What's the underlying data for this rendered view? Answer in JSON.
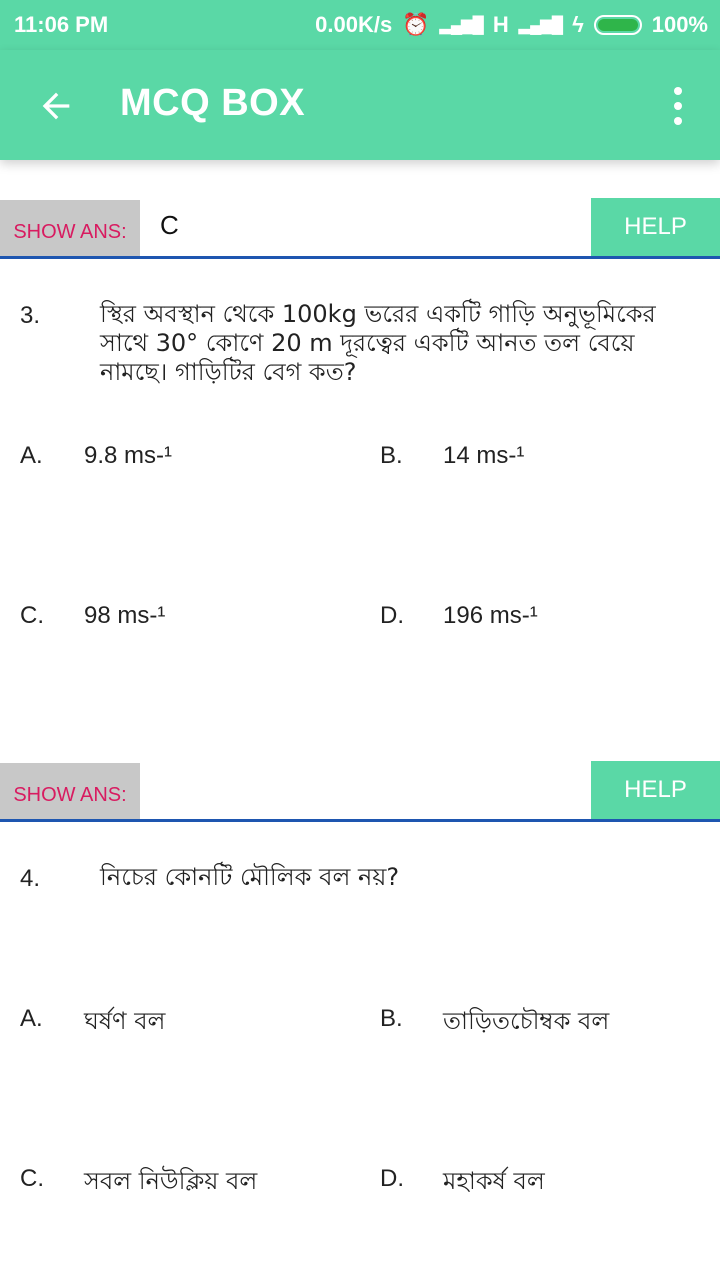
{
  "status_bar": {
    "time": "11:06 PM",
    "net_speed": "0.00K/s",
    "network": "H",
    "battery": "100%",
    "battery_level": 1.0
  },
  "app_bar": {
    "title": "MCQ BOX",
    "back_icon": "arrow-left-icon",
    "menu_icon": "more-vert-icon"
  },
  "questions": [
    {
      "show_ans_label": "SHOW ANS:",
      "answer": "C",
      "help_label": "HELP",
      "number": "3.",
      "text": "স্থির অবস্থান থেকে 100kg ভরের একটি গাড়ি অনুভূমিকের সাথে 30° কোণে 20 m দূরত্বের একটি আনত তল বেয়ে নামছে। গাড়িটির বেগ কত?",
      "options": [
        {
          "letter": "A.",
          "text": "9.8 ms-¹"
        },
        {
          "letter": "B.",
          "text": "14 ms-¹"
        },
        {
          "letter": "C.",
          "text": "98 ms-¹"
        },
        {
          "letter": "D.",
          "text": "196 ms-¹"
        }
      ]
    },
    {
      "show_ans_label": "SHOW ANS:",
      "answer": "",
      "help_label": "HELP",
      "number": "4.",
      "text": "নিচের কোনটি মৌলিক বল নয়?",
      "options": [
        {
          "letter": "A.",
          "text": "ঘর্ষণ বল"
        },
        {
          "letter": "B.",
          "text": "তাড়িতচৌম্বক বল"
        },
        {
          "letter": "C.",
          "text": "সবল নিউক্লিয় বল"
        },
        {
          "letter": "D.",
          "text": "মহাকর্ষ বল"
        }
      ]
    }
  ],
  "colors": {
    "primary": "#5ad8a6",
    "show_ans_bg": "#c8c8c8",
    "show_ans_text": "#d81b60",
    "divider": "#1e56b0"
  }
}
